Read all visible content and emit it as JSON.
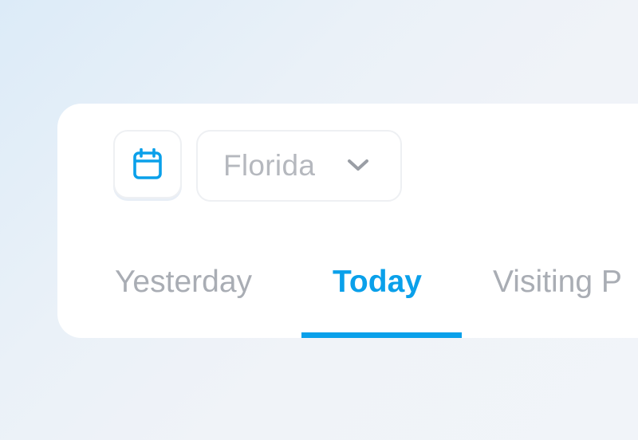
{
  "filter_bar": {
    "calendar_icon": "calendar-icon",
    "location_select": {
      "value": "Florida",
      "icon": "chevron-down-icon"
    }
  },
  "tabs": [
    {
      "label": "Yesterday",
      "active": false
    },
    {
      "label": "Today",
      "active": true
    },
    {
      "label": "Visiting P",
      "active": false
    }
  ],
  "colors": {
    "accent": "#0aa0ea",
    "muted_text": "#a9adb4",
    "card_background": "#ffffff",
    "page_background": "#eef2f8"
  }
}
